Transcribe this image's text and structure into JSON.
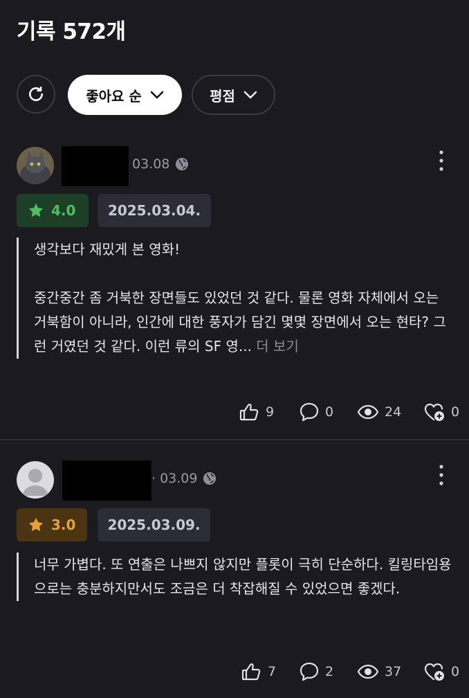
{
  "header": {
    "title": "기록 572개"
  },
  "filters": {
    "sort_label": "좋아요 순",
    "rating_label": "평점"
  },
  "reviews": [
    {
      "date_short": "03.08",
      "rating": "4.0",
      "watch_date": "2025.03.04.",
      "paragraphs": [
        "생각보다 재밌게 본 영화!",
        "중간중간 좀 거북한 장면들도 있었던 것 같다. 물론 영화 자체에서 오는 거북함이 아니라, 인간에 대한 풍자가 담긴 몇몇 장면에서 오는 현타? 그런 거였던 것 같다. 이런 류의 SF 영..."
      ],
      "more_label": "더 보기",
      "likes": "9",
      "comments": "0",
      "views": "24",
      "saves": "0"
    },
    {
      "date_short": "· 03.09",
      "rating": "3.0",
      "watch_date": "2025.03.09.",
      "paragraphs": [
        "너무 가볍다. 또 연출은 나쁘지 않지만 플롯이 극히 단순하다. 킬링타임용으로는 충분하지만서도 조금은 더 착잡해질 수 있었으면 좋겠다."
      ],
      "likes": "7",
      "comments": "2",
      "views": "37",
      "saves": "0"
    }
  ],
  "colors": {
    "background": "#1a1a1f",
    "rating_green": "#4fbf63",
    "rating_orange": "#e8a23a"
  },
  "icons": {
    "refresh": "refresh-icon",
    "chevron": "chevron-down-icon",
    "globe": "globe-icon",
    "more": "more-vertical-icon",
    "star": "star-icon",
    "like": "thumbs-up-icon",
    "comment": "comment-icon",
    "view": "eye-icon",
    "save": "heart-plus-icon"
  }
}
